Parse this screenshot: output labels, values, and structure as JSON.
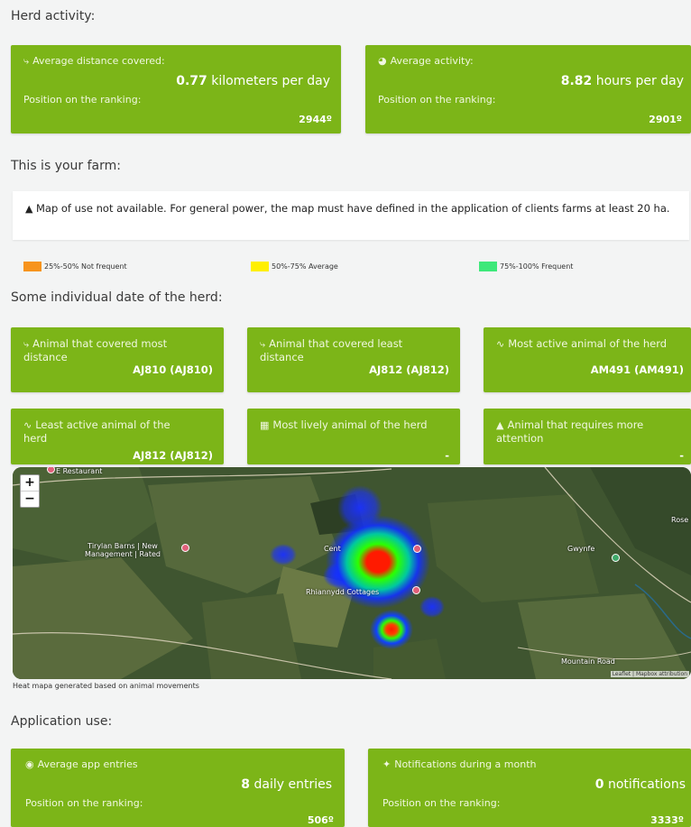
{
  "herd_activity": {
    "title": "Herd activity:",
    "distance": {
      "label": "Average distance covered:",
      "value": "0.77",
      "unit": "kilometers per day",
      "ranking_label": "Position on the ranking:",
      "ranking": "2944º"
    },
    "activity": {
      "label": "Average activity:",
      "value": "8.82",
      "unit": "hours per day",
      "ranking_label": "Position on the ranking:",
      "ranking": "2901º"
    }
  },
  "farm": {
    "title": "This is your farm:",
    "notice": "Map of use not available. For general power, the map must have defined in the application of clients farms at least 20 ha.",
    "legend": [
      {
        "label": "25%-50% Not frequent",
        "color": "#f7941d"
      },
      {
        "label": "50%-75% Average",
        "color": "#ffef00"
      },
      {
        "label": "75%-100% Frequent",
        "color": "#3ee87a"
      }
    ]
  },
  "individual": {
    "title": "Some individual date of the herd:",
    "cards": [
      {
        "icon": "distance-icon",
        "title": "Animal that covered most distance",
        "value": "AJ810 (AJ810)"
      },
      {
        "icon": "distance-icon",
        "title": "Animal that covered least distance",
        "value": "AJ812 (AJ812)"
      },
      {
        "icon": "activity-icon",
        "title": "Most active animal of the herd",
        "value": "AM491 (AM491)"
      },
      {
        "icon": "activity-icon",
        "title": "Least active animal of the herd",
        "value": "AJ812 (AJ812)"
      },
      {
        "icon": "map-icon",
        "title": "Most lively animal of the herd",
        "value": "-"
      },
      {
        "icon": "bell-icon",
        "title": "Animal that requires more attention",
        "value": "-"
      }
    ]
  },
  "map": {
    "zoom_in": "+",
    "zoom_out": "−",
    "labels": [
      "E Restaurant",
      "Tirylan Barns | New Management | Rated",
      "Cent",
      "Rhiannydd Cottages",
      "Gwynfe",
      "Mountain Road",
      "Rose"
    ],
    "attribution": "Leaflet | Mapbox attribution",
    "caption": "Heat mapa generated based on animal movements"
  },
  "app_use": {
    "title": "Application use:",
    "entries": {
      "label": "Average app entries",
      "value": "8",
      "unit": "daily entries",
      "ranking_label": "Position on the ranking:",
      "ranking": "506º"
    },
    "notifications": {
      "label": "Notifications during a month",
      "value": "0",
      "unit": "notifications",
      "ranking_label": "Position on the ranking:",
      "ranking": "3333º"
    }
  }
}
